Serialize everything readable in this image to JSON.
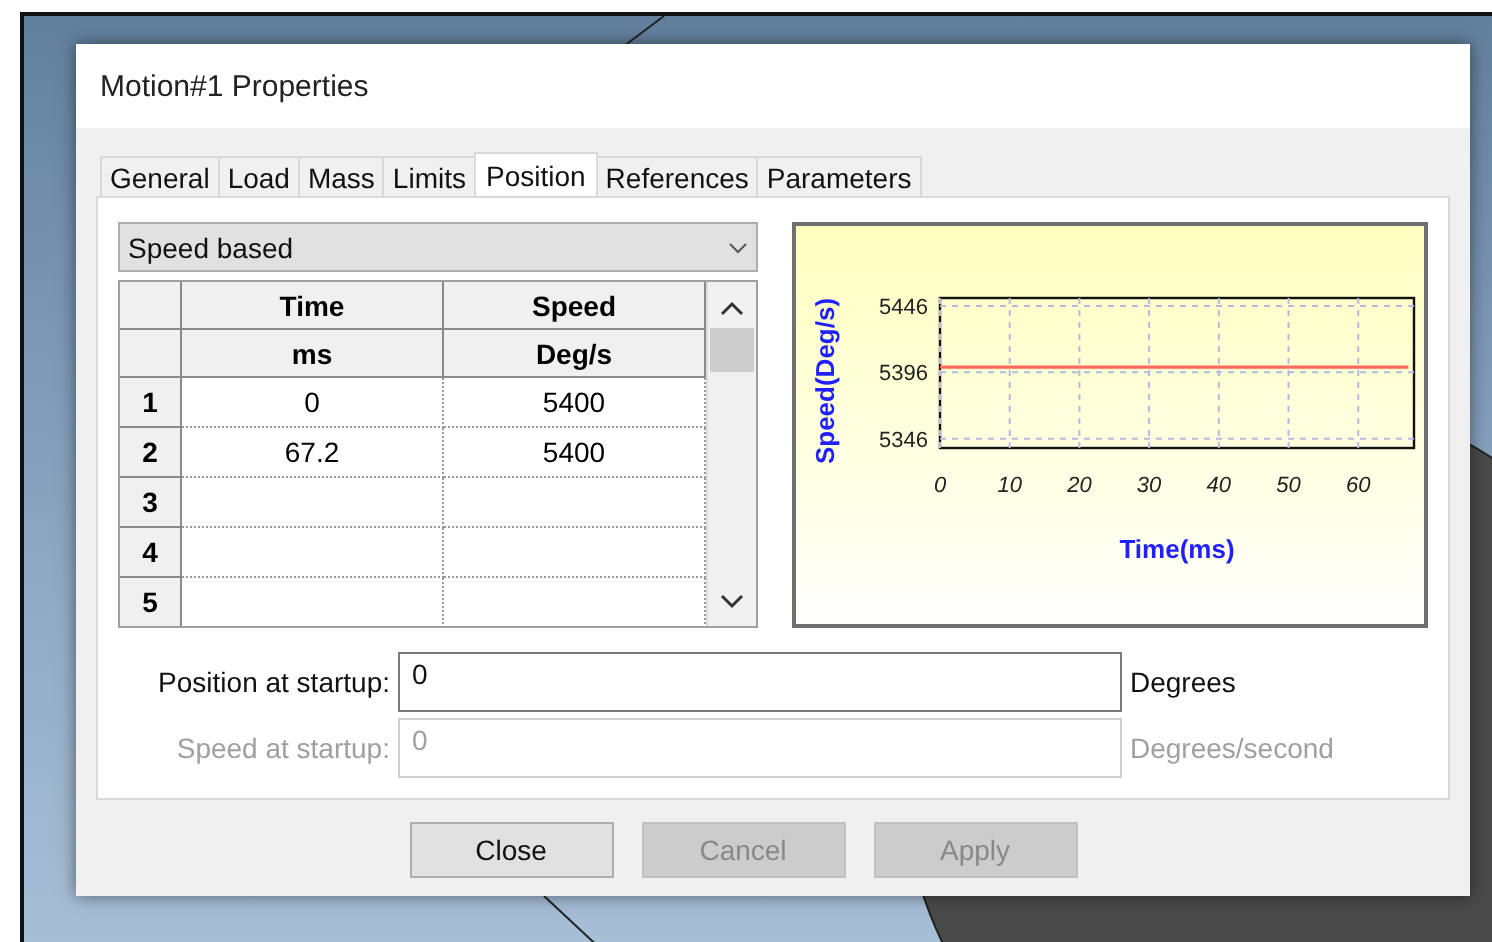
{
  "window": {
    "title": "Motion#1 Properties"
  },
  "tabs": [
    {
      "label": "General",
      "selected": false
    },
    {
      "label": "Load",
      "selected": false
    },
    {
      "label": "Mass",
      "selected": false
    },
    {
      "label": "Limits",
      "selected": false
    },
    {
      "label": "Position",
      "selected": true
    },
    {
      "label": "References",
      "selected": false
    },
    {
      "label": "Parameters",
      "selected": false
    }
  ],
  "mode_select": {
    "value": "Speed based"
  },
  "table": {
    "columns": [
      {
        "name": "Time",
        "unit": "ms"
      },
      {
        "name": "Speed",
        "unit": "Deg/s"
      }
    ],
    "rows": [
      {
        "index": "1",
        "cells": [
          "0",
          "5400"
        ]
      },
      {
        "index": "2",
        "cells": [
          "67.2",
          "5400"
        ]
      },
      {
        "index": "3",
        "cells": []
      },
      {
        "index": "4",
        "cells": []
      },
      {
        "index": "5",
        "cells": []
      }
    ]
  },
  "chart": {
    "chart_data": {
      "type": "line",
      "xlabel": "Time(ms)",
      "ylabel": "Speed(Deg/s)",
      "x": [
        0,
        67.2
      ],
      "grid": true,
      "series": [
        {
          "color": "#ff6a5a",
          "values": [
            5400,
            5400
          ]
        }
      ],
      "xlim": [
        0,
        68
      ],
      "ylim": [
        5339,
        5452
      ],
      "xticks": [
        0,
        10,
        20,
        30,
        40,
        50,
        60
      ],
      "yticks": [
        5346,
        5396,
        5446
      ]
    }
  },
  "fields": [
    {
      "label": "Position at startup:",
      "value": "0",
      "unit": "Degrees",
      "disabled": false
    },
    {
      "label": "Speed at startup:",
      "value": "0",
      "unit": "Degrees/second",
      "disabled": true
    }
  ],
  "buttons": [
    {
      "label": "Close",
      "disabled": false
    },
    {
      "label": "Cancel",
      "disabled": true
    },
    {
      "label": "Apply",
      "disabled": true
    }
  ]
}
